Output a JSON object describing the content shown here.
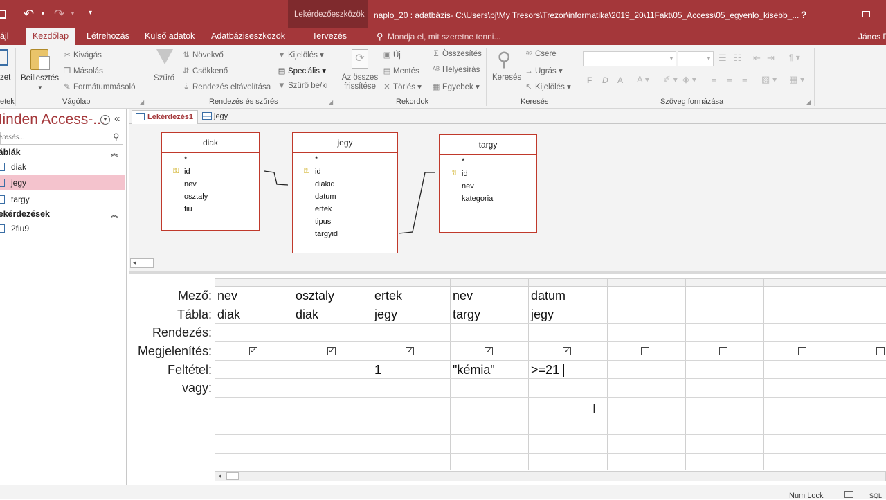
{
  "window": {
    "title": "naplo_20 : adatbázis- C:\\Users\\pj\\My Tresors\\Trezor\\informatika\\2019_20\\11Fakt\\05_Access\\05_egyenlo_kisebb_...",
    "context_tab": "Lekérdezőeszközök",
    "user": "János P",
    "help": "?"
  },
  "ribbon_tabs": [
    "ájl",
    "Kezdőlap",
    "Létrehozás",
    "Külső adatok",
    "Adatbáziseszközök",
    "Tervezés"
  ],
  "tell_me": "Mondja el, mit szeretne tenni...",
  "ribbon": {
    "view_partial": "zet",
    "view_group_partial": "etek",
    "clipboard": {
      "paste": "Beillesztés",
      "cut": "Kivágás",
      "copy": "Másolás",
      "format_painter": "Formátummásoló",
      "label": "Vágólap"
    },
    "sort_filter": {
      "filter": "Szűrő",
      "ascending": "Növekvő",
      "descending": "Csökkenő",
      "remove_sort": "Rendezés eltávolítása",
      "selection": "Kijelölés",
      "advanced": "Speciális",
      "toggle_filter": "Szűrő be/ki",
      "label": "Rendezés és szűrés"
    },
    "records": {
      "refresh_all": "Az összes frissítése",
      "new": "Új",
      "save": "Mentés",
      "delete": "Törlés",
      "totals": "Összesítés",
      "spelling": "Helyesírás",
      "more": "Egyebek",
      "label": "Rekordok"
    },
    "find": {
      "find": "Keresés",
      "replace": "Csere",
      "goto": "Ugrás",
      "select": "Kijelölés",
      "label": "Keresés"
    },
    "text_format": {
      "bold": "F",
      "italic": "D",
      "underline": "A",
      "label": "Szöveg formázása"
    }
  },
  "nav": {
    "title": "Minden Access-...",
    "search_placeholder": "Keresés...",
    "sections": [
      {
        "label": "Táblák",
        "items": [
          "diak",
          "jegy",
          "targy"
        ]
      },
      {
        "label": "Lekérdezések",
        "items": [
          "2fiu9"
        ]
      }
    ],
    "selected": "jegy"
  },
  "doc_tabs": [
    "Lekérdezés1",
    "jegy"
  ],
  "tables": [
    {
      "name": "diak",
      "fields": [
        "*",
        "id",
        "nev",
        "osztaly",
        "fiu"
      ],
      "key": "id"
    },
    {
      "name": "jegy",
      "fields": [
        "*",
        "id",
        "diakid",
        "datum",
        "ertek",
        "tipus",
        "targyid"
      ],
      "key": "id"
    },
    {
      "name": "targy",
      "fields": [
        "*",
        "id",
        "nev",
        "kategoria"
      ],
      "key": "id"
    }
  ],
  "grid": {
    "row_labels": [
      "Mező:",
      "Tábla:",
      "Rendezés:",
      "Megjelenítés:",
      "Feltétel:",
      "vagy:"
    ],
    "columns": [
      {
        "field": "nev",
        "table": "diak",
        "show": true,
        "criteria": ""
      },
      {
        "field": "osztaly",
        "table": "diak",
        "show": true,
        "criteria": ""
      },
      {
        "field": "ertek",
        "table": "jegy",
        "show": true,
        "criteria": "1"
      },
      {
        "field": "nev",
        "table": "targy",
        "show": true,
        "criteria": "\"kémia\""
      },
      {
        "field": "datum",
        "table": "jegy",
        "show": true,
        "criteria": ">=21"
      },
      {
        "field": "",
        "table": "",
        "show": false,
        "criteria": ""
      },
      {
        "field": "",
        "table": "",
        "show": false,
        "criteria": ""
      },
      {
        "field": "",
        "table": "",
        "show": false,
        "criteria": ""
      },
      {
        "field": "",
        "table": "",
        "show": false,
        "criteria": ""
      }
    ]
  },
  "status": {
    "numlock": "Num Lock",
    "sql": "SQL"
  }
}
